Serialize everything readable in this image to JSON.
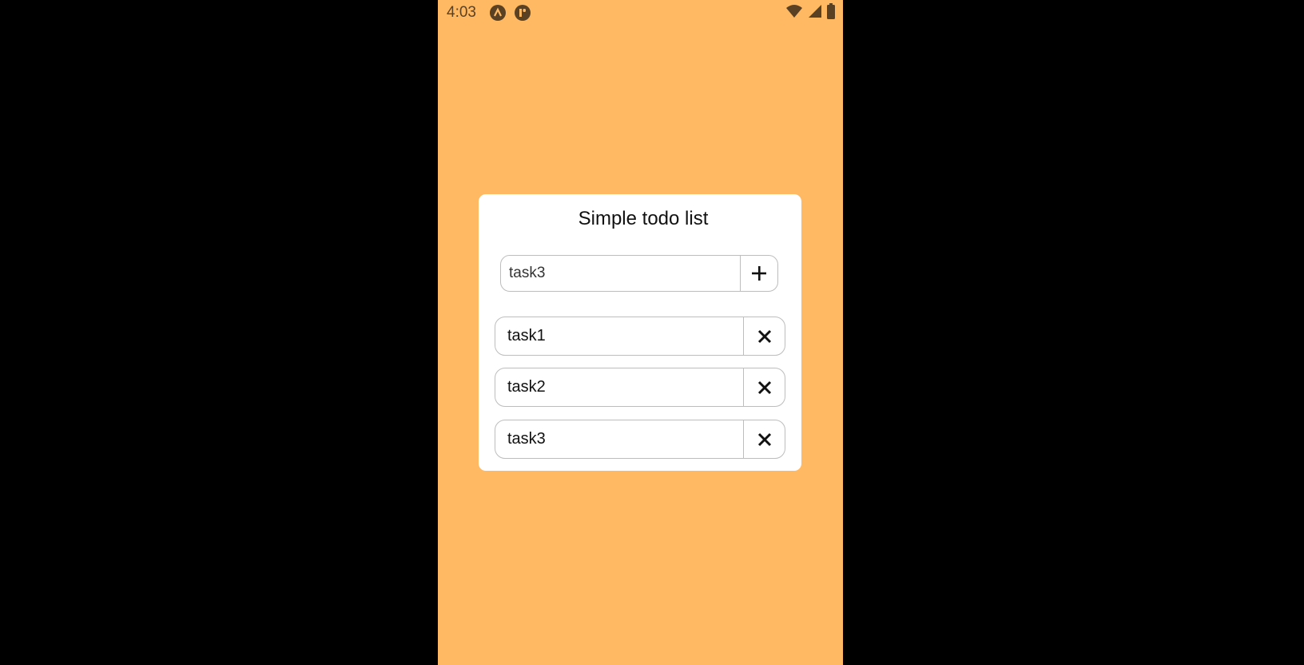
{
  "status_bar": {
    "time": "4:03",
    "icons": [
      "app-a-icon",
      "app-r-icon",
      "wifi-icon",
      "cellular-signal-icon",
      "battery-icon"
    ],
    "icon_color": "#5a4124"
  },
  "theme": {
    "background": "#ffb963",
    "card": "#ffffff",
    "border": "#bdbdbd"
  },
  "app": {
    "title": "Simple todo list",
    "input": {
      "value": "task3",
      "add_icon": "plus-icon"
    },
    "tasks": [
      {
        "label": "task1",
        "delete_icon": "close-icon"
      },
      {
        "label": "task2",
        "delete_icon": "close-icon"
      },
      {
        "label": "task3",
        "delete_icon": "close-icon"
      }
    ]
  }
}
